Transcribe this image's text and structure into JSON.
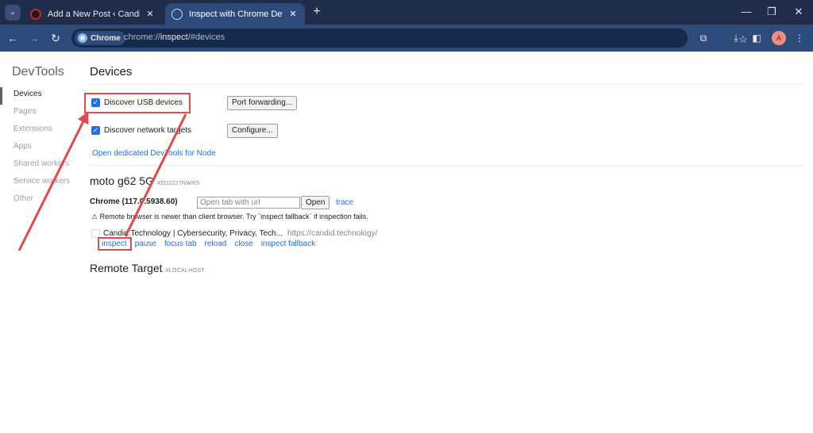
{
  "browser": {
    "tabs": [
      {
        "title": "Add a New Post ‹ Candid.Techn",
        "active": false
      },
      {
        "title": "Inspect with Chrome Develope",
        "active": true
      }
    ],
    "address": {
      "chip": "Chrome",
      "url_prefix": "chrome://",
      "url_host": "inspect",
      "url_rest": "/#devices"
    },
    "avatar_letter": "A"
  },
  "devtools": {
    "brand": "DevTools",
    "sidebar": [
      "Devices",
      "Pages",
      "Extensions",
      "Apps",
      "Shared workers",
      "Service workers",
      "Other"
    ],
    "active_section": "Devices",
    "heading": "Devices",
    "discover_usb": {
      "label": "Discover USB devices",
      "checked": true
    },
    "port_forwarding_button": "Port forwarding...",
    "discover_network": {
      "label": "Discover network targets",
      "checked": true
    },
    "configure_button": "Configure...",
    "node_link": "Open dedicated DevTools for Node",
    "device": {
      "name": "moto g62 5G",
      "serial": "#ZD2227NWRS",
      "browser": "Chrome (117.0.5938.60)",
      "open_tab_placeholder": "Open tab with url",
      "open_button": "Open",
      "trace_link": "trace",
      "warning": "⚠ Remote browser is newer than client browser. Try `inspect fallback` if inspection fails.",
      "target_title": "Candid.Technology | Cybersecurity, Privacy, Tech...",
      "target_url": "https://candid.technology/",
      "actions": [
        "inspect",
        "pause",
        "focus tab",
        "reload",
        "close",
        "inspect fallback"
      ]
    },
    "remote_target": {
      "name": "Remote Target",
      "sub": "#LOCALHOST"
    }
  },
  "colors": {
    "accent": "#1a73e8",
    "annotation": "#e04a4a",
    "tabstrip": "#1f2d4a",
    "toolbar": "#2c4a7a"
  },
  "icons": [
    "tab-search-icon",
    "close-icon",
    "new-tab-icon",
    "minimize-icon",
    "restore-icon",
    "window-close-icon",
    "back-icon",
    "forward-icon",
    "reload-icon",
    "bookmark-star-icon",
    "extensions-icon",
    "downloads-icon",
    "side-panel-icon",
    "menu-icon"
  ]
}
